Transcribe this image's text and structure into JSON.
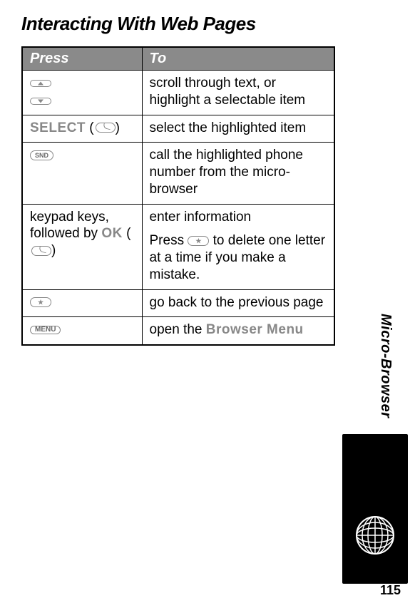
{
  "title": "Interacting With Web Pages",
  "header": {
    "col1": "Press",
    "col2": "To"
  },
  "rows": [
    {
      "press_type": "nav-arrows",
      "to": "scroll through text, or highlight a selectable item"
    },
    {
      "press_type": "select-softkey",
      "lcd": "SELECT",
      "to": "select the highlighted item"
    },
    {
      "press_type": "snd-key",
      "key_label": "SND",
      "to": "call the highlighted phone number from the micro-browser"
    },
    {
      "press_type": "keypad-ok",
      "text_before": "keypad keys, followed by ",
      "lcd": "OK",
      "to_line1": "enter information",
      "to_line2_pre": "Press ",
      "to_line2_post": " to delete one letter at a time if you make a mistake."
    },
    {
      "press_type": "star-key",
      "key_label": "★",
      "to": "go back to the previous page"
    },
    {
      "press_type": "menu-key",
      "key_label": "MENU",
      "to_pre": "open the ",
      "to_lcd": "Browser Menu"
    }
  ],
  "side_label": "Micro-Browser",
  "page_number": "115"
}
